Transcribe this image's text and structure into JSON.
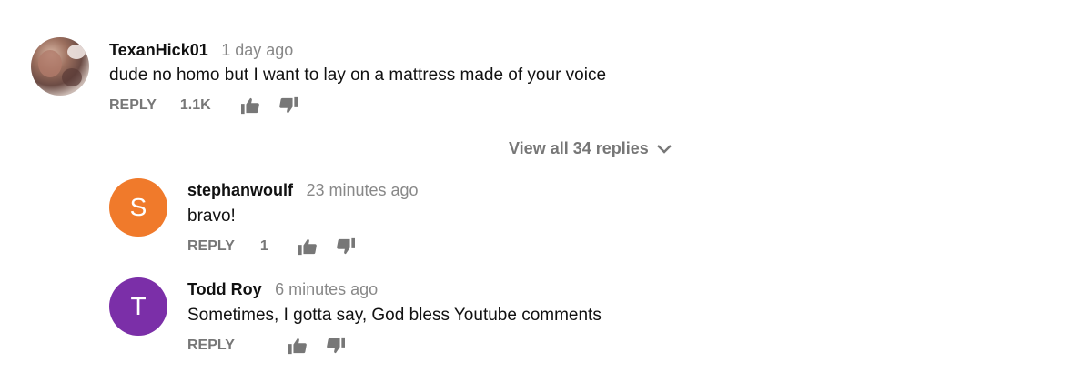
{
  "comments": [
    {
      "author": "TexanHick01",
      "time": "1 day ago",
      "text": "dude no homo but I want to lay on a mattress made of your voice",
      "reply_label": "REPLY",
      "likes": "1.1K",
      "avatar": {
        "type": "photo"
      }
    }
  ],
  "view_replies_label": "View all 34 replies",
  "replies": [
    {
      "author": "stephanwoulf",
      "time": "23 minutes ago",
      "text": "bravo!",
      "reply_label": "REPLY",
      "likes": "1",
      "avatar": {
        "letter": "S",
        "color": "#f07a2b"
      }
    },
    {
      "author": "Todd Roy",
      "time": "6 minutes ago",
      "text": "Sometimes, I gotta say, God bless Youtube comments",
      "reply_label": "REPLY",
      "likes": "",
      "avatar": {
        "letter": "T",
        "color": "#7b2fa8"
      }
    }
  ],
  "colors": {
    "meta_gray": "#888888",
    "action_gray": "#777777"
  }
}
